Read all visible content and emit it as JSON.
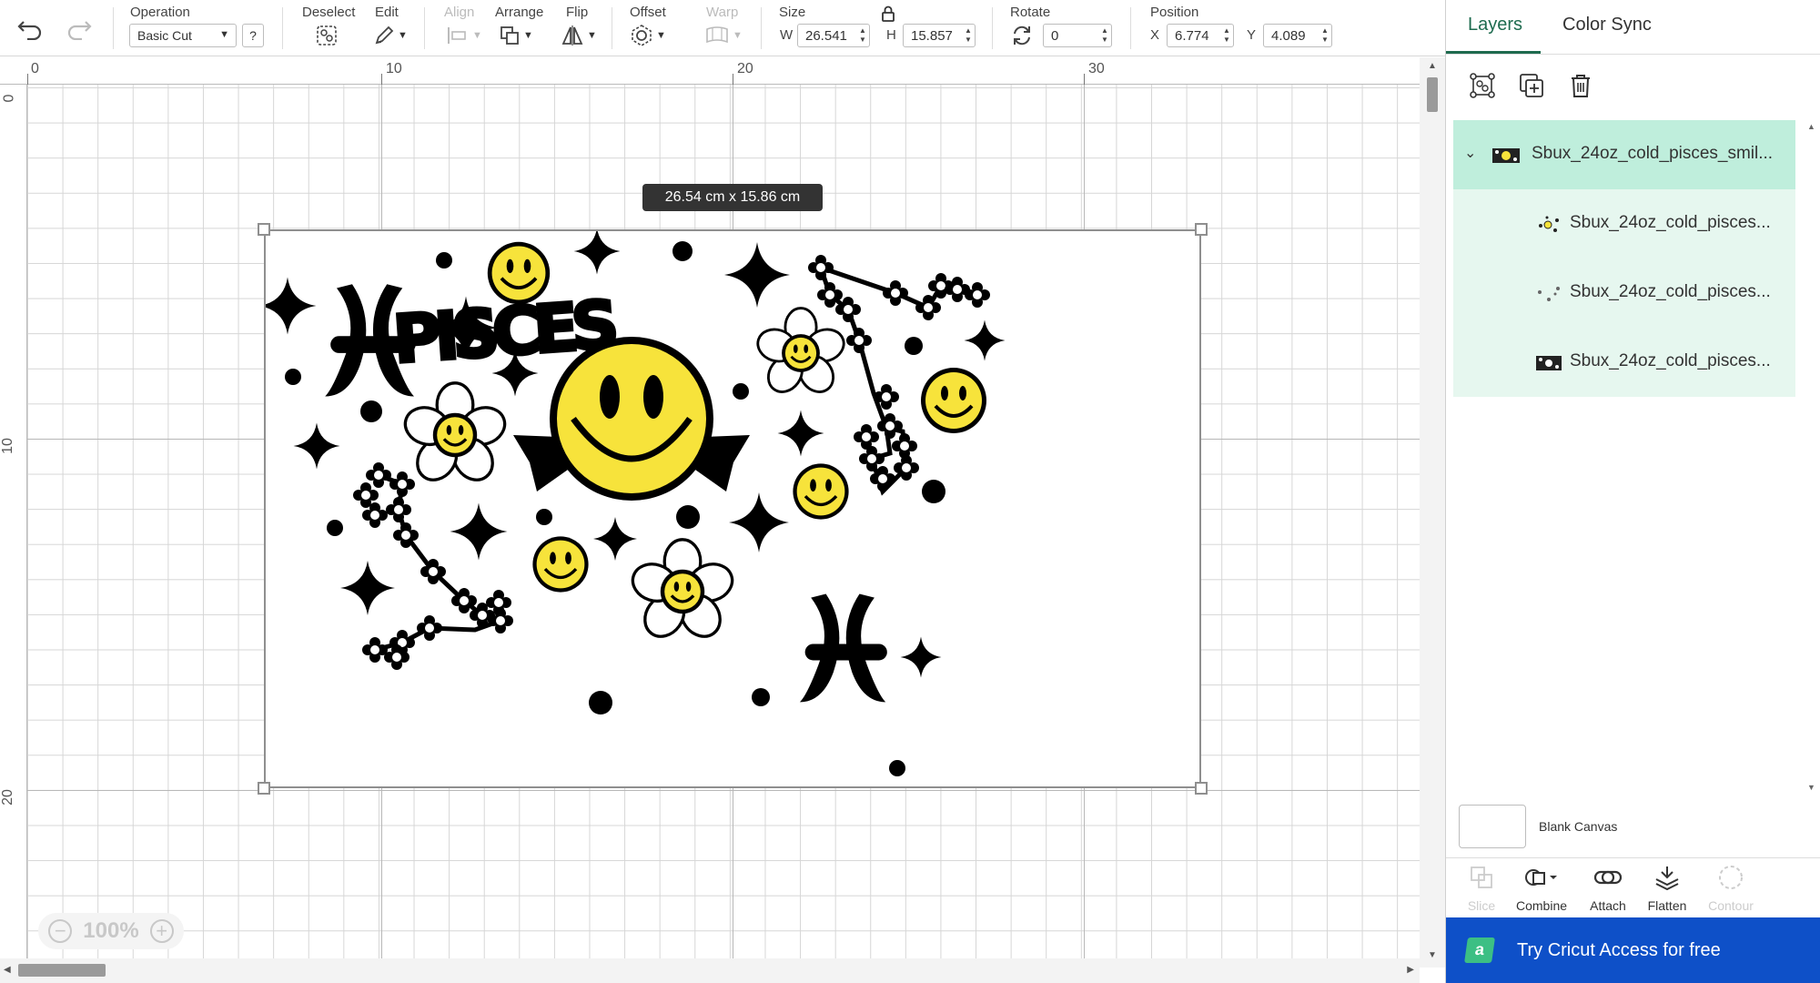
{
  "toolbar": {
    "operation_label": "Operation",
    "operation_value": "Basic Cut",
    "help": "?",
    "deselect_label": "Deselect",
    "edit_label": "Edit",
    "align_label": "Align",
    "arrange_label": "Arrange",
    "flip_label": "Flip",
    "offset_label": "Offset",
    "warp_label": "Warp",
    "size_label": "Size",
    "w_label": "W",
    "w_value": "26.541",
    "h_label": "H",
    "h_value": "15.857",
    "rotate_label": "Rotate",
    "rotate_value": "0",
    "position_label": "Position",
    "x_label": "X",
    "x_value": "6.774",
    "y_label": "Y",
    "y_value": "4.089"
  },
  "rulers": {
    "top": [
      "0",
      "10",
      "20",
      "30"
    ],
    "left": [
      "0",
      "10",
      "20"
    ]
  },
  "canvas": {
    "dimension_tooltip": "26.54  cm x 15.86  cm",
    "design_title": "PISCES",
    "zoom_value": "100%",
    "zoom_out": "−",
    "zoom_in": "+"
  },
  "panel": {
    "tabs": [
      "Layers",
      "Color Sync"
    ],
    "active_tab": "Layers",
    "layers": [
      {
        "name": "Sbux_24oz_cold_pisces_smil...",
        "type": "group",
        "icon": "image-thumb-icon"
      },
      {
        "name": "Sbux_24oz_cold_pisces...",
        "type": "item",
        "icon": "dots-thumb-icon"
      },
      {
        "name": "Sbux_24oz_cold_pisces...",
        "type": "item",
        "icon": "dots-thumb-icon"
      },
      {
        "name": "Sbux_24oz_cold_pisces...",
        "type": "item",
        "icon": "image-thumb-icon"
      }
    ],
    "blank_canvas_label": "Blank Canvas",
    "actions": [
      {
        "label": "Slice",
        "enabled": false
      },
      {
        "label": "Combine",
        "enabled": true
      },
      {
        "label": "Attach",
        "enabled": true
      },
      {
        "label": "Flatten",
        "enabled": true
      },
      {
        "label": "Contour",
        "enabled": false
      }
    ],
    "promo_text": "Try Cricut Access for free",
    "promo_icon_letter": "a"
  },
  "colors": {
    "accent_green": "#1e6b4f",
    "layer_selected": "#bfeedc",
    "promo_blue": "#0e50c8",
    "smiley_yellow": "#f7e33b"
  }
}
